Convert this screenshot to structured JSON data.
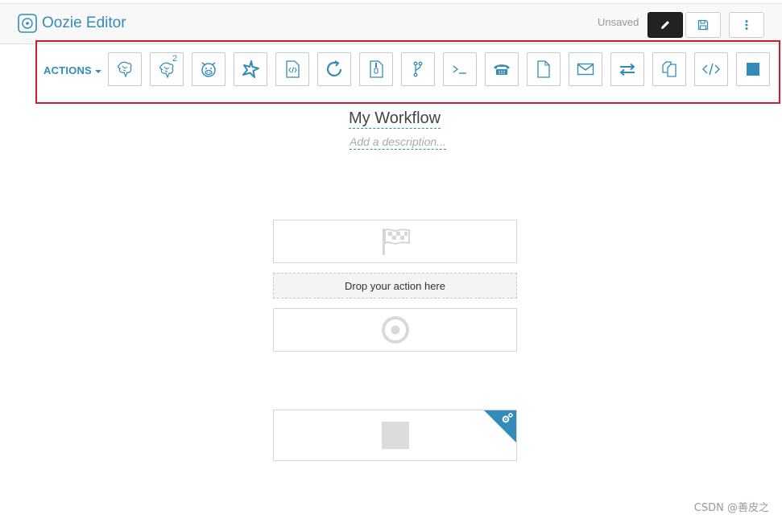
{
  "header": {
    "app_title": "Oozie Editor",
    "status_text": "Unsaved",
    "buttons": {
      "edit": "pencil-icon",
      "save": "save-icon",
      "more": "more-vertical-icon"
    }
  },
  "toolbar": {
    "actions_label": "ACTIONS",
    "items": [
      {
        "icon": "hive-icon",
        "superscript": ""
      },
      {
        "icon": "hive2-icon",
        "superscript": "2"
      },
      {
        "icon": "pig-icon",
        "superscript": ""
      },
      {
        "icon": "spark-icon",
        "superscript": ""
      },
      {
        "icon": "java-file-icon",
        "superscript": ""
      },
      {
        "icon": "sub-workflow-icon",
        "superscript": ""
      },
      {
        "icon": "jar-file-icon",
        "superscript": ""
      },
      {
        "icon": "git-fork-icon",
        "superscript": ""
      },
      {
        "icon": "shell-terminal-icon",
        "superscript": ""
      },
      {
        "icon": "ssh-phone-icon",
        "superscript": ""
      },
      {
        "icon": "file-icon",
        "superscript": ""
      },
      {
        "icon": "email-icon",
        "superscript": ""
      },
      {
        "icon": "distcp-arrows-icon",
        "superscript": ""
      },
      {
        "icon": "copy-files-icon",
        "superscript": ""
      },
      {
        "icon": "code-icon",
        "superscript": ""
      },
      {
        "icon": "stop-square-icon",
        "superscript": ""
      }
    ]
  },
  "workflow": {
    "name": "My Workflow",
    "description_placeholder": "Add a description..."
  },
  "canvas": {
    "drop_zone_text": "Drop your action here"
  },
  "watermark": "CSDN @善皮之",
  "colors": {
    "accent": "#338bb8",
    "highlight": "#cc1f2d",
    "node_icon_gray": "#d9d9d9"
  }
}
